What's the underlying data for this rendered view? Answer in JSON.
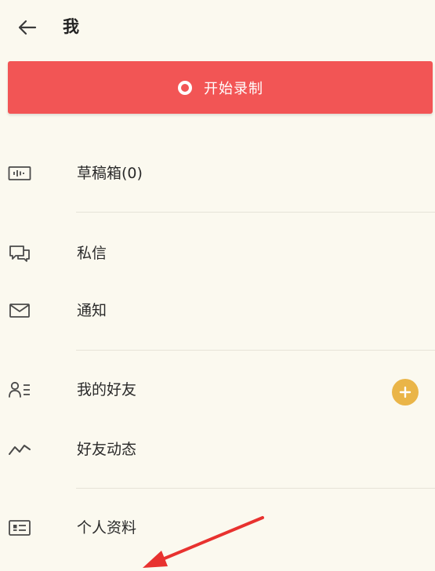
{
  "header": {
    "back_icon": "arrow-left-icon",
    "title": "我"
  },
  "record_button": {
    "icon": "record-circle-icon",
    "label": "开始录制",
    "color": "#f25555"
  },
  "menu": {
    "items": [
      {
        "icon": "drafts-waveform-icon",
        "label": "草稿箱(0)"
      },
      {
        "icon": "message-chat-icon",
        "label": "私信"
      },
      {
        "icon": "mail-envelope-icon",
        "label": "通知"
      },
      {
        "icon": "friends-list-icon",
        "label": "我的好友"
      },
      {
        "icon": "activity-trend-icon",
        "label": "好友动态"
      },
      {
        "icon": "profile-card-icon",
        "label": "个人资料"
      }
    ],
    "add_friend_icon": "plus-icon",
    "add_friend_color": "#eab548"
  },
  "annotation": {
    "arrow_color": "#e8322f"
  }
}
